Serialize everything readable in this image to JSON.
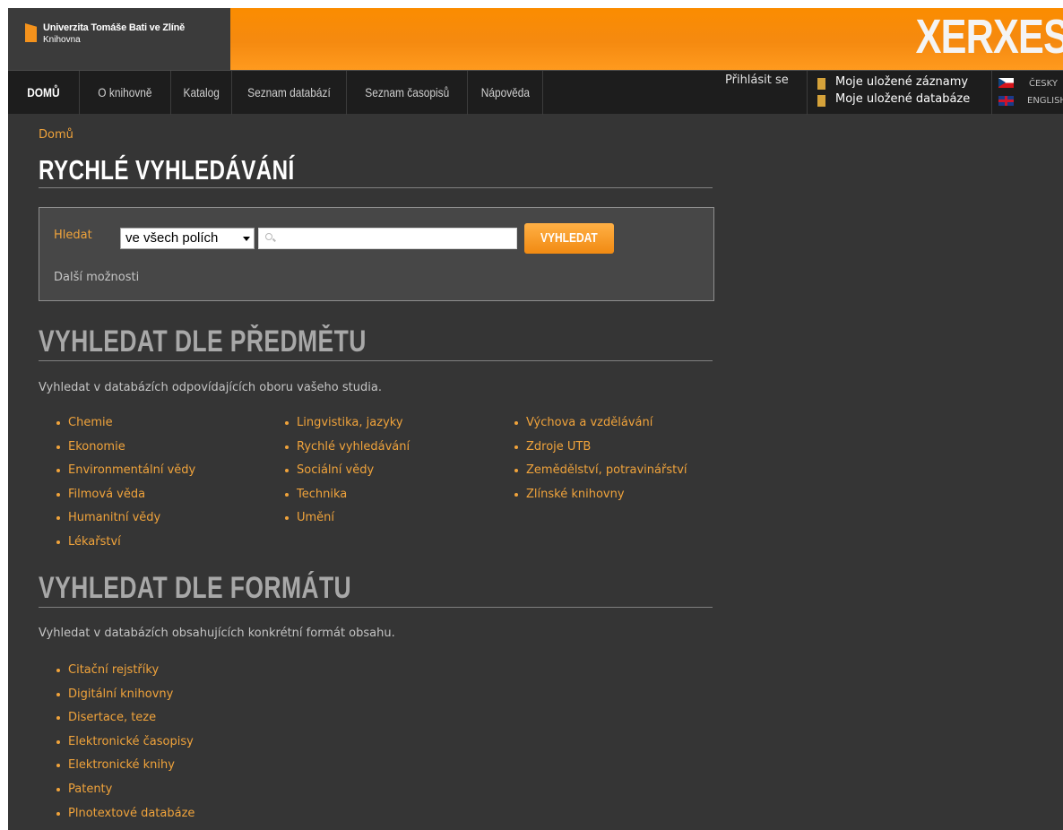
{
  "header": {
    "institution": "Univerzita Tomáše Bati ve Zlíně",
    "library": "Knihovna",
    "brand": "XERXES",
    "colors": {
      "orange": "#fb8c00",
      "accent": "#f0a33b"
    }
  },
  "nav": {
    "items": [
      {
        "label": "DOMŮ",
        "active": true
      },
      {
        "label": "O knihovně"
      },
      {
        "label": "Katalog"
      },
      {
        "label": "Seznam databází"
      },
      {
        "label": "Seznam časopisů"
      },
      {
        "label": "Nápověda"
      }
    ],
    "login": "Přihlásit se",
    "saved_records": "Moje uložené záznamy",
    "saved_databases": "Moje uložené databáze",
    "lang_cs": "ČESKY",
    "lang_en": "ENGLISH"
  },
  "breadcrumb": "Domů",
  "quick_search": {
    "title": "RYCHLÉ VYHLEDÁVÁNÍ",
    "label": "Hledat",
    "field_select": "ve všech polích",
    "query": "",
    "button": "VYHLEDAT",
    "more_options": "Další možnosti"
  },
  "by_subject": {
    "title": "VYHLEDAT DLE PŘEDMĚTU",
    "description": "Vyhledat v databázích odpovídajících oboru vašeho studia.",
    "columns": [
      [
        "Chemie",
        "Ekonomie",
        "Environmentální vědy",
        "Filmová věda",
        "Humanitní vědy",
        "Lékařství"
      ],
      [
        "Lingvistika, jazyky",
        "Rychlé vyhledávání",
        "Sociální vědy",
        "Technika",
        "Umění"
      ],
      [
        "Výchova a vzdělávání",
        "Zdroje UTB",
        "Zemědělství, potravinářství",
        "Zlínské knihovny"
      ]
    ]
  },
  "by_format": {
    "title": "VYHLEDAT DLE FORMÁTU",
    "description": "Vyhledat v databázích obsahujících konkrétní formát obsahu.",
    "items": [
      "Citační rejstříky",
      "Digitální knihovny",
      "Disertace, teze",
      "Elektronické časopisy",
      "Elektronické knihy",
      "Patenty",
      "Plnotextové databáze"
    ]
  }
}
